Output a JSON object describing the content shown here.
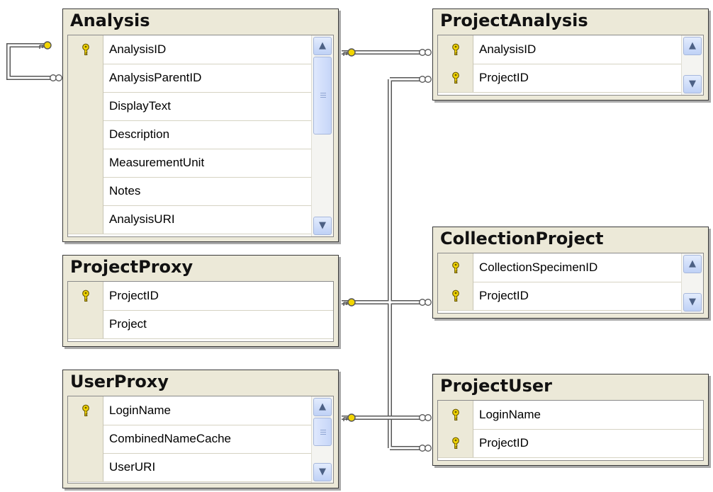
{
  "tables": {
    "analysis": {
      "title": "Analysis",
      "columns": [
        {
          "name": "AnalysisID",
          "key": true
        },
        {
          "name": "AnalysisParentID",
          "key": false
        },
        {
          "name": "DisplayText",
          "key": false
        },
        {
          "name": "Description",
          "key": false
        },
        {
          "name": "MeasurementUnit",
          "key": false
        },
        {
          "name": "Notes",
          "key": false
        },
        {
          "name": "AnalysisURI",
          "key": false
        }
      ]
    },
    "project_analysis": {
      "title": "ProjectAnalysis",
      "columns": [
        {
          "name": "AnalysisID",
          "key": true
        },
        {
          "name": "ProjectID",
          "key": true
        }
      ]
    },
    "project_proxy": {
      "title": "ProjectProxy",
      "columns": [
        {
          "name": "ProjectID",
          "key": true
        },
        {
          "name": "Project",
          "key": false
        }
      ]
    },
    "collection_project": {
      "title": "CollectionProject",
      "columns": [
        {
          "name": "CollectionSpecimenID",
          "key": true
        },
        {
          "name": "ProjectID",
          "key": true
        }
      ]
    },
    "user_proxy": {
      "title": "UserProxy",
      "columns": [
        {
          "name": "LoginName",
          "key": true
        },
        {
          "name": "CombinedNameCache",
          "key": false
        },
        {
          "name": "UserURI",
          "key": false
        }
      ]
    },
    "project_user": {
      "title": "ProjectUser",
      "columns": [
        {
          "name": "LoginName",
          "key": true
        },
        {
          "name": "ProjectID",
          "key": true
        }
      ]
    }
  },
  "relationships": [
    {
      "from": "Analysis",
      "to": "Analysis",
      "type": "one-to-many"
    },
    {
      "from": "Analysis",
      "to": "ProjectAnalysis",
      "type": "one-to-many"
    },
    {
      "from": "ProjectProxy",
      "to": "ProjectAnalysis",
      "type": "one-to-many"
    },
    {
      "from": "ProjectProxy",
      "to": "CollectionProject",
      "type": "one-to-many"
    },
    {
      "from": "ProjectProxy",
      "to": "ProjectUser",
      "type": "one-to-many"
    },
    {
      "from": "UserProxy",
      "to": "ProjectUser",
      "type": "one-to-many"
    }
  ],
  "colors": {
    "key_gold": "#f2d500",
    "line": "#555555",
    "window": "#ece9d8"
  }
}
